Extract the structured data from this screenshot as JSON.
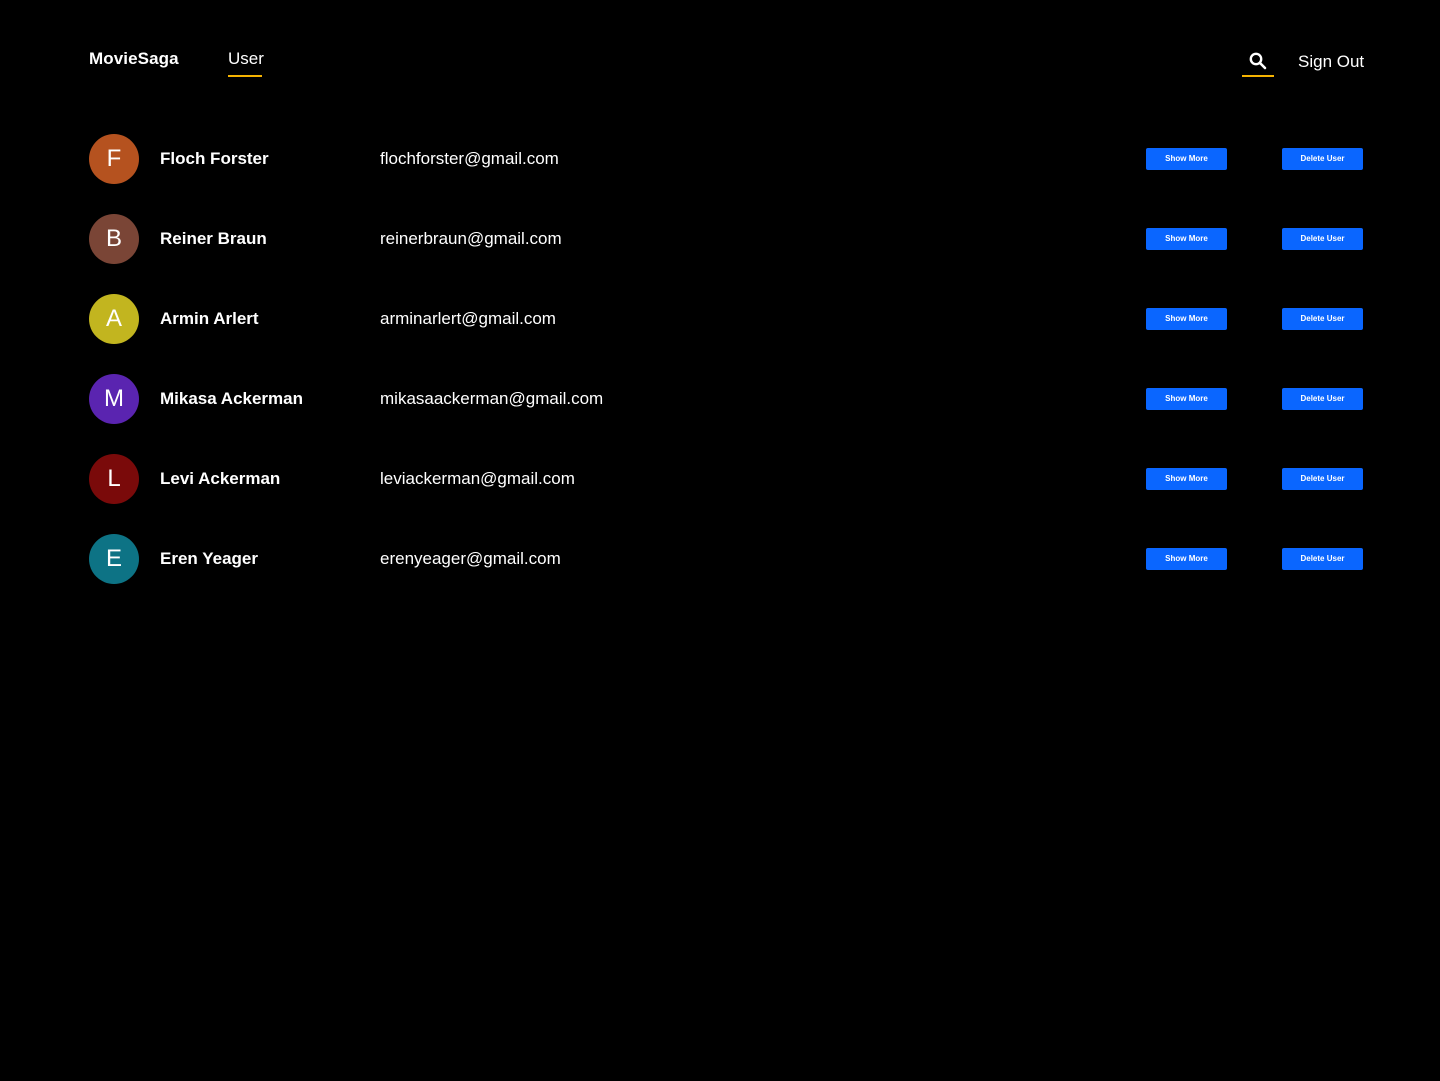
{
  "header": {
    "brand": "MovieSaga",
    "nav_tab": "User",
    "sign_out": "Sign Out",
    "accent_color": "#f5b301"
  },
  "users": [
    {
      "initial": "F",
      "name": "Floch Forster",
      "email": "flochforster@gmail.com",
      "avatar_color": "#b5521f"
    },
    {
      "initial": "B",
      "name": "Reiner Braun",
      "email": "reinerbraun@gmail.com",
      "avatar_color": "#7a4536"
    },
    {
      "initial": "A",
      "name": "Armin Arlert",
      "email": "arminarlert@gmail.com",
      "avatar_color": "#c2b51f"
    },
    {
      "initial": "M",
      "name": "Mikasa Ackerman",
      "email": "mikasaackerman@gmail.com",
      "avatar_color": "#5a24b0"
    },
    {
      "initial": "L",
      "name": "Levi Ackerman",
      "email": "leviackerman@gmail.com",
      "avatar_color": "#7a0a0a"
    },
    {
      "initial": "E",
      "name": "Eren Yeager",
      "email": "erenyeager@gmail.com",
      "avatar_color": "#0d7385"
    }
  ],
  "buttons": {
    "show_more": "Show More",
    "delete_user": "Delete User",
    "color": "#0a66ff"
  }
}
